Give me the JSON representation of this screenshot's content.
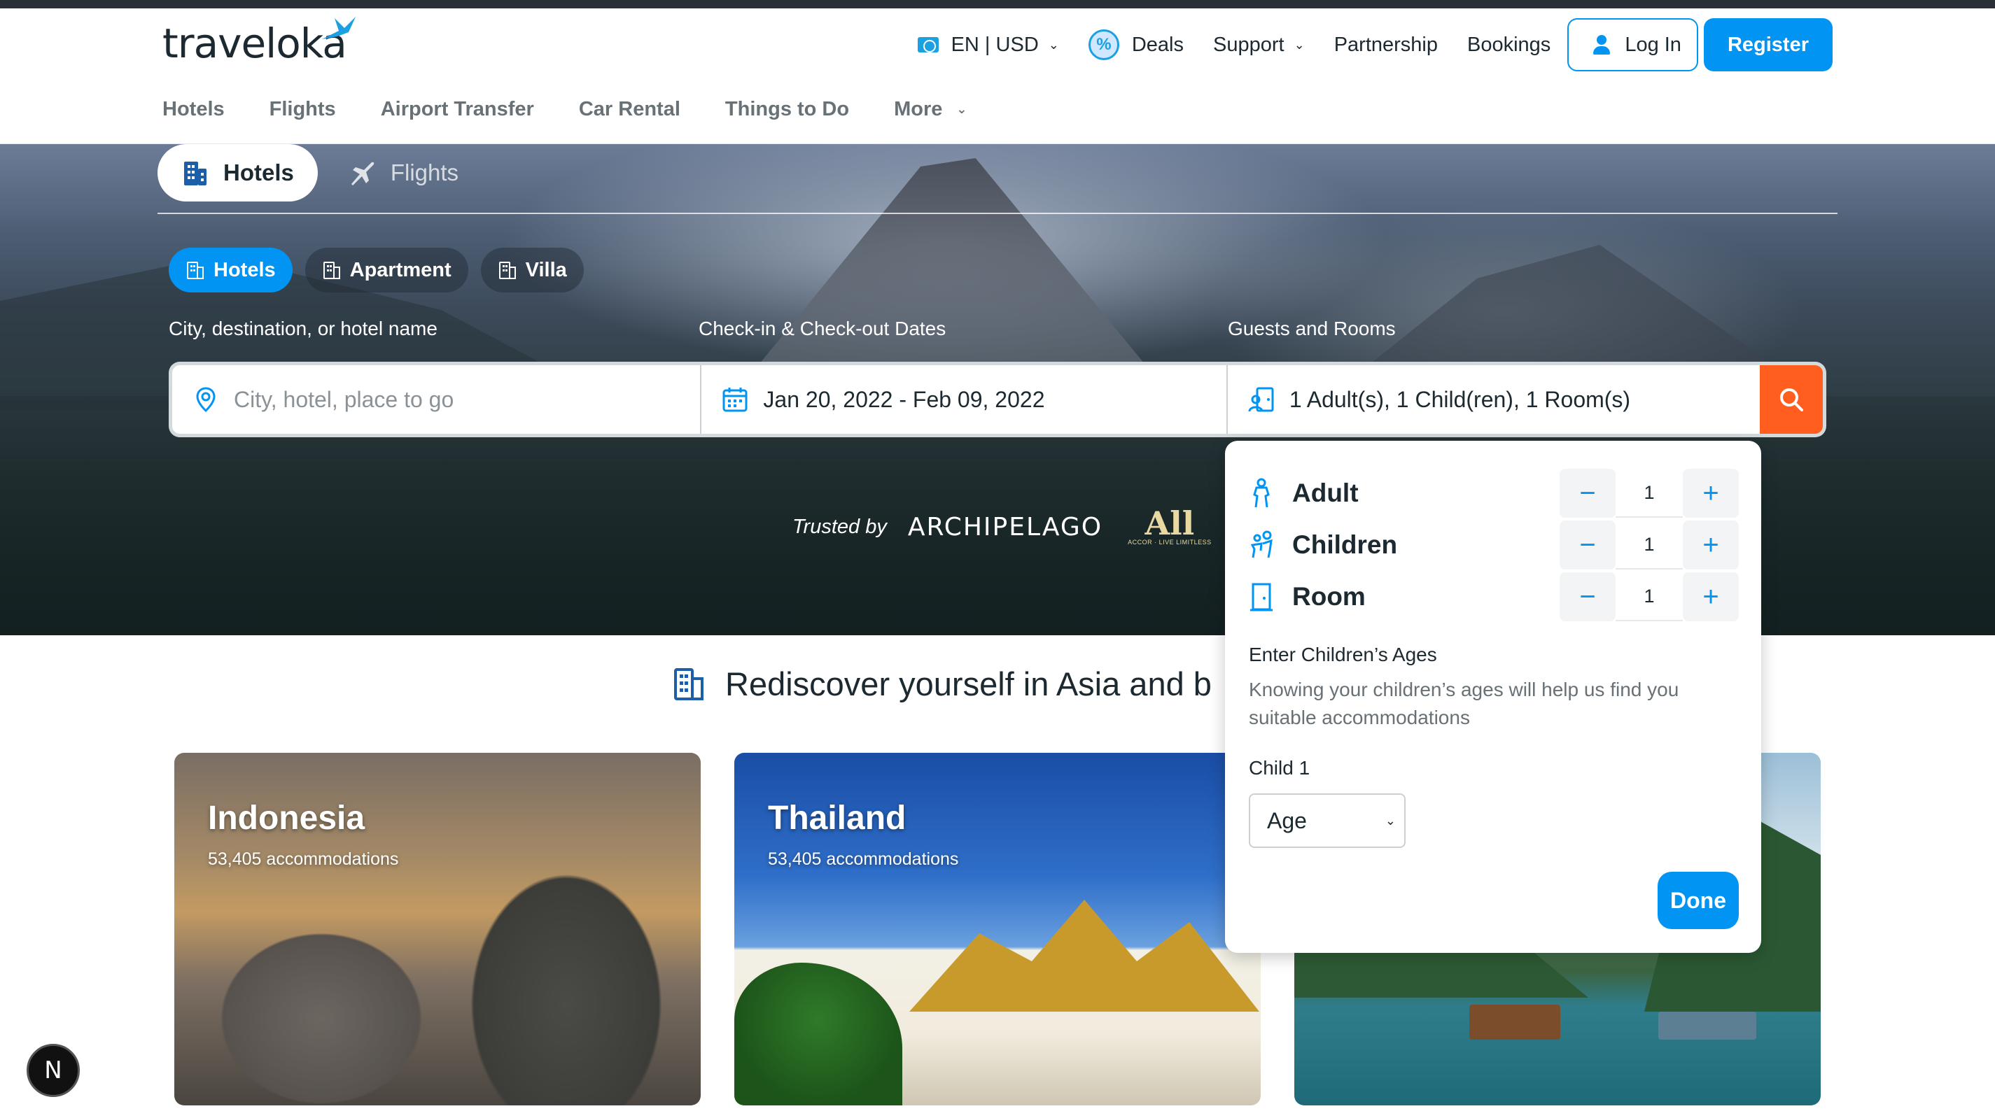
{
  "header": {
    "logo_text": "traveloka",
    "lang_currency": "EN | USD",
    "deals": "Deals",
    "support": "Support",
    "partnership": "Partnership",
    "bookings": "Bookings",
    "login": "Log In",
    "register": "Register",
    "nav": [
      "Hotels",
      "Flights",
      "Airport Transfer",
      "Car Rental",
      "Things to Do",
      "More"
    ]
  },
  "hero": {
    "tabs": [
      "Hotels",
      "Flights"
    ],
    "sub_tabs": [
      "Hotels",
      "Apartment",
      "Villa"
    ],
    "labels": {
      "destination": "City, destination, or hotel name",
      "dates": "Check-in & Check-out Dates",
      "guests": "Guests and Rooms"
    },
    "destination_placeholder": "City, hotel, place to go",
    "dates_value": "Jan 20, 2022 - Feb 09, 2022",
    "guests_value": "1 Adult(s), 1 Child(ren), 1 Room(s)",
    "trusted_by": "Trusted by",
    "partner1": "ARCHIPELAGO",
    "partner2": "All",
    "partner2_sub": "ACCOR · LIVE LIMITLESS"
  },
  "guests_popup": {
    "rows": [
      {
        "label": "Adult",
        "value": "1"
      },
      {
        "label": "Children",
        "value": "1"
      },
      {
        "label": "Room",
        "value": "1"
      }
    ],
    "minus": "−",
    "plus": "+",
    "children_ages_title": "Enter Children’s Ages",
    "children_ages_desc": "Knowing your children’s ages will help us find you suitable accommodations",
    "child_label": "Child 1",
    "age_selected": "Age",
    "done": "Done"
  },
  "section": {
    "title": "Rediscover yourself in Asia and b",
    "cards": [
      {
        "title": "Indonesia",
        "subtitle": "53,405 accommodations"
      },
      {
        "title": "Thailand",
        "subtitle": "53,405 accommodations"
      },
      {
        "title": "",
        "subtitle": ""
      }
    ]
  },
  "badge": "N",
  "colors": {
    "accent": "#0194f3",
    "search_button": "#ff5e1f",
    "text_primary": "#1c2930",
    "text_muted": "#687176"
  },
  "icons": [
    "globe-flag-icon",
    "deals-percent-icon",
    "user-icon",
    "hotel-building-icon",
    "airplane-icon",
    "location-pin-icon",
    "calendar-icon",
    "guests-icon",
    "search-icon",
    "adult-icon",
    "children-icon",
    "room-door-icon",
    "chevron-down-icon"
  ]
}
